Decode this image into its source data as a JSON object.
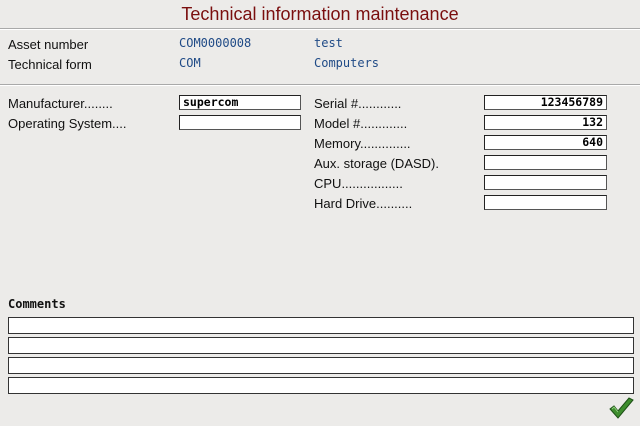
{
  "window": {
    "title": "Technical information maintenance"
  },
  "header": {
    "asset_number": {
      "label": "Asset number",
      "code": "COM0000008",
      "desc": "test"
    },
    "technical_form": {
      "label": "Technical form",
      "code": "COM",
      "desc": "Computers"
    }
  },
  "left_fields": {
    "manufacturer": {
      "label": "Manufacturer........",
      "value": "supercom"
    },
    "operating_system": {
      "label": "Operating System....",
      "value": ""
    }
  },
  "right_fields": {
    "serial": {
      "label": "Serial #............",
      "value": "123456789"
    },
    "model": {
      "label": "Model #.............",
      "value": "132"
    },
    "memory": {
      "label": "Memory..............",
      "value": "640"
    },
    "aux_storage": {
      "label": "Aux. storage (DASD).",
      "value": ""
    },
    "cpu": {
      "label": "CPU.................",
      "value": ""
    },
    "hard_drive": {
      "label": "Hard Drive..........",
      "value": ""
    }
  },
  "comments": {
    "label": "Comments",
    "lines": [
      "",
      "",
      "",
      ""
    ]
  },
  "actions": {
    "ok_icon": "green-checkmark-icon"
  },
  "colors": {
    "title": "#7a0e0e",
    "value_text": "#1f4a86",
    "background": "#ecebe9",
    "checkmark": "#3e8d2e"
  }
}
